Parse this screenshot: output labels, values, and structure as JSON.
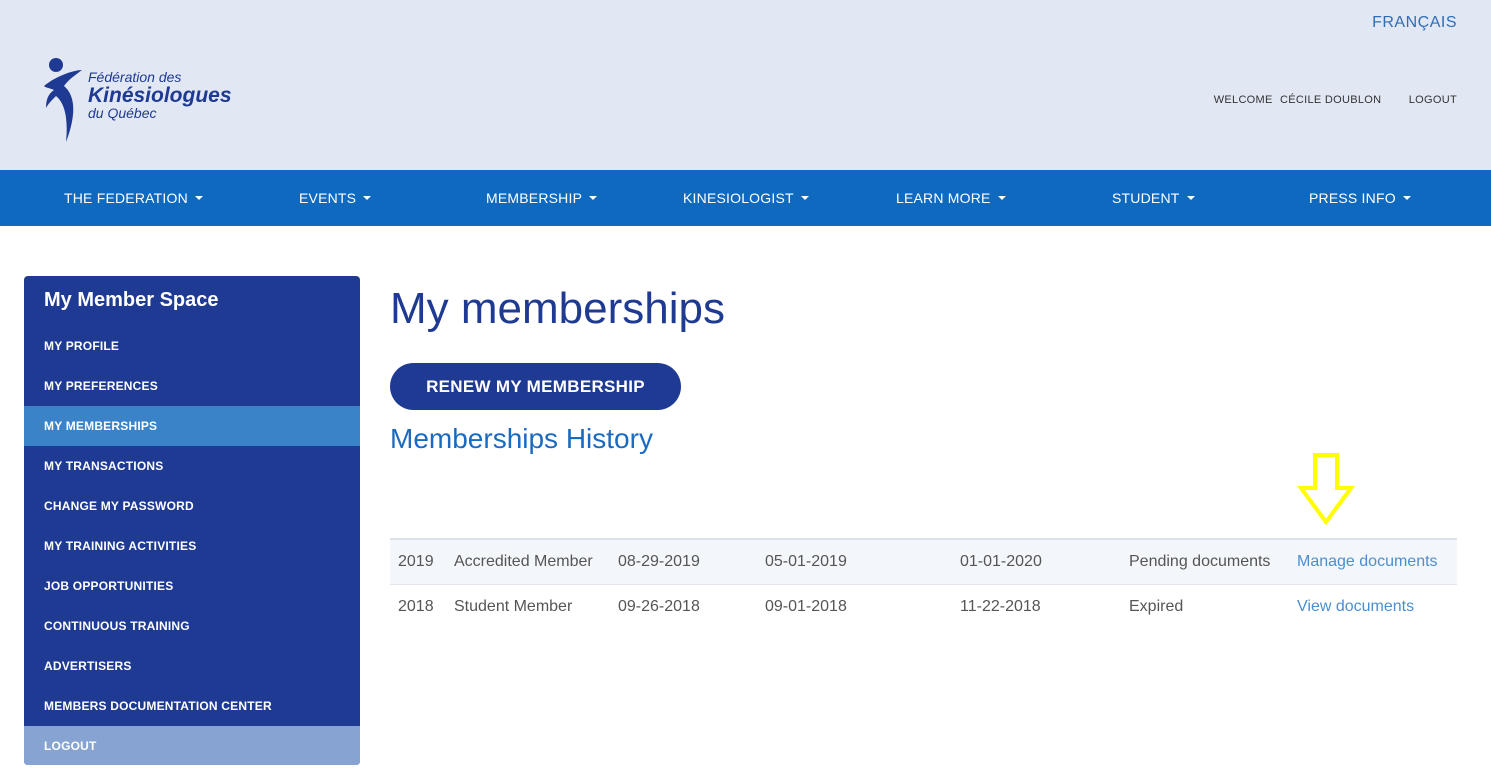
{
  "header": {
    "language_link": "FRANÇAIS",
    "logo": {
      "line1": "Fédération des",
      "line2": "Kinésiologues",
      "line3": "du Québec"
    },
    "welcome_label": "WELCOME",
    "user_name": "CÉCILE DOUBLON",
    "logout_label": "LOGOUT"
  },
  "nav": {
    "items": [
      {
        "label": "THE FEDERATION"
      },
      {
        "label": "EVENTS"
      },
      {
        "label": "MEMBERSHIP"
      },
      {
        "label": "KINESIOLOGIST"
      },
      {
        "label": "LEARN MORE"
      },
      {
        "label": "STUDENT"
      },
      {
        "label": "PRESS INFO"
      }
    ]
  },
  "sidebar": {
    "title": "My Member Space",
    "items": [
      {
        "label": "MY PROFILE"
      },
      {
        "label": "MY PREFERENCES"
      },
      {
        "label": "MY MEMBERSHIPS"
      },
      {
        "label": "MY TRANSACTIONS"
      },
      {
        "label": "CHANGE MY PASSWORD"
      },
      {
        "label": "MY TRAINING ACTIVITIES"
      },
      {
        "label": "JOB OPPORTUNITIES"
      },
      {
        "label": "CONTINUOUS TRAINING"
      },
      {
        "label": "ADVERTISERS"
      },
      {
        "label": "MEMBERS DOCUMENTATION CENTER"
      },
      {
        "label": "LOGOUT"
      }
    ],
    "active_item": "MY MEMBERSHIPS"
  },
  "main": {
    "title": "My memberships",
    "renew_button": "RENEW MY MEMBERSHIP",
    "history_title": "Memberships History",
    "history_rows": [
      {
        "year": "2019",
        "type": "Accredited Member",
        "date1": "08-29-2019",
        "date2": "05-01-2019",
        "date3": "01-01-2020",
        "status": "Pending documents",
        "action": "Manage documents"
      },
      {
        "year": "2018",
        "type": "Student Member",
        "date1": "09-26-2018",
        "date2": "09-01-2018",
        "date3": "11-22-2018",
        "status": "Expired",
        "action": "View documents"
      }
    ],
    "annotation_arrow_color": "#ffff00"
  },
  "colors": {
    "header_bg": "#e1e7f3",
    "nav_bg": "#0e69bf",
    "sidebar_bg": "#1f3a93",
    "sidebar_active": "#3a83c8",
    "sidebar_logout": "#87a3d2",
    "title_blue": "#1f3a93",
    "link_blue": "#4d8ecf"
  }
}
